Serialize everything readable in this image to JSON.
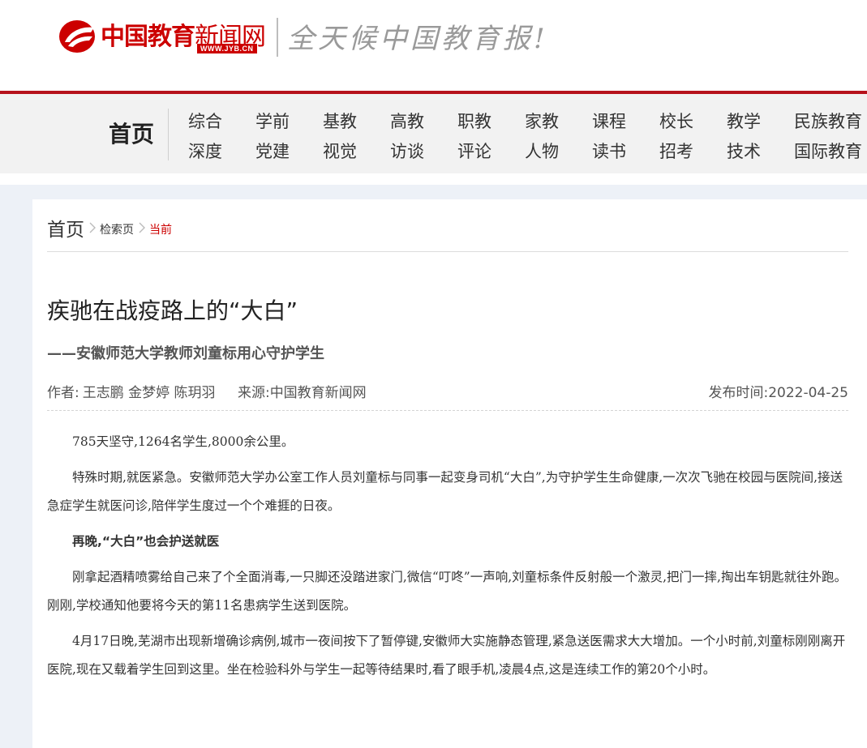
{
  "header": {
    "logo_text_bold": "中国教育",
    "logo_text_light": "新闻网",
    "logo_url": "WWW.JYB.CN",
    "slogan": "全天候中国教育报!"
  },
  "nav": {
    "home": "首页",
    "row1": [
      "综合",
      "学前",
      "基教",
      "高教",
      "职教",
      "家教",
      "课程",
      "校长",
      "教学",
      "民族教育"
    ],
    "row2": [
      "深度",
      "党建",
      "视觉",
      "访谈",
      "评论",
      "人物",
      "读书",
      "招考",
      "技术",
      "国际教育"
    ]
  },
  "breadcrumb": {
    "home": "首页",
    "search": "检索页",
    "current": "当前"
  },
  "article": {
    "title": "疾驰在战疫路上的“大白”",
    "subtitle": "——安徽师范大学教师刘童标用心守护学生",
    "author_label": "作者:",
    "authors": "王志鹏 金梦婷 陈玥羽",
    "source_label": "来源:",
    "source": "中国教育新闻网",
    "date_label": "发布时间:",
    "date": "2022-04-25",
    "paragraphs": [
      "785天坚守,1264名学生,8000余公里。",
      "特殊时期,就医紧急。安徽师范大学办公室工作人员刘童标与同事一起变身司机“大白”,为守护学生生命健康,一次次飞驰在校园与医院间,接送急症学生就医问诊,陪伴学生度过一个个难捱的日夜。",
      "再晚,“大白”也会护送就医",
      "刚拿起酒精喷雾给自己来了个全面消毒,一只脚还没踏进家门,微信“叮咚”一声响,刘童标条件反射般一个激灵,把门一摔,掏出车钥匙就往外跑。刚刚,学校通知他要将今天的第11名患病学生送到医院。",
      "4月17日晚,芜湖市出现新增确诊病例,城市一夜间按下了暂停键,安徽师大实施静态管理,紧急送医需求大大增加。一个小时前,刘童标刚刚离开医院,现在又载着学生回到这里。坐在检验科外与学生一起等待结果时,看了眼手机,凌晨4点,这是连续工作的第20个小时。"
    ]
  },
  "colors": {
    "brand_red": "#c00000",
    "nav_bar": "#f2f2f2",
    "page_bg": "#edf1f7"
  }
}
